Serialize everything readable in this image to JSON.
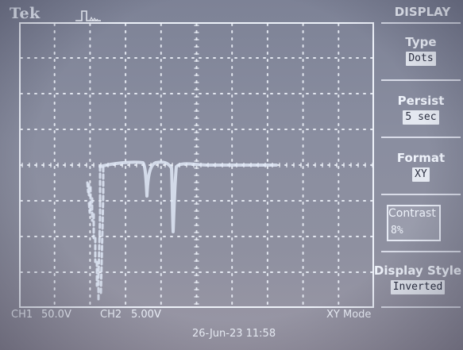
{
  "brand": "Tek",
  "header": {
    "trigger_icon": "trigger-pulse-icon"
  },
  "menu": {
    "title": "DISPLAY",
    "items": [
      {
        "label": "Type",
        "value": "Dots"
      },
      {
        "label": "Persist",
        "value": "5 sec"
      },
      {
        "label": "Format",
        "value": "XY"
      },
      {
        "label": "Contrast",
        "value": "8%"
      },
      {
        "label": "Display Style",
        "value": "Inverted"
      }
    ]
  },
  "status": {
    "ch1_label": "CH1",
    "ch1_scale": "50.0V",
    "ch2_label": "CH2",
    "ch2_scale": "5.00V",
    "datetime": "26-Jun-23 11:58",
    "mode": "XY Mode"
  },
  "colors": {
    "screen": "#8a8ea0",
    "grid": "#eef2fa",
    "trace": "#dfe8f6"
  }
}
